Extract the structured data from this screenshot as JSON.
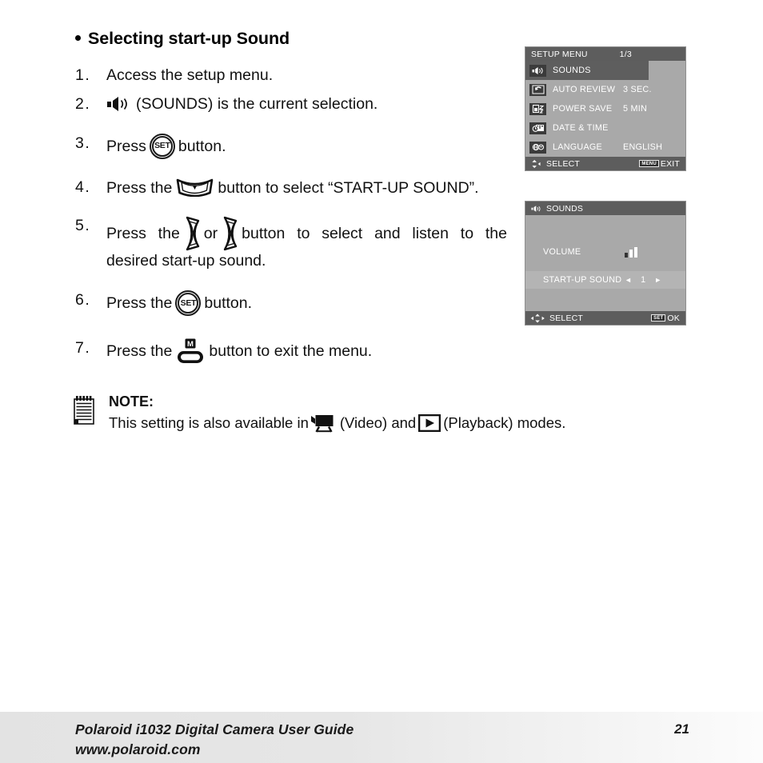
{
  "heading": "Selecting start-up Sound",
  "steps": [
    {
      "num": "1.",
      "text": "Access the setup menu."
    },
    {
      "num": "2.",
      "icon": "speaker-icon",
      "text": "(SOUNDS) is the current selection."
    },
    {
      "num": "3.",
      "pre": "Press",
      "icon": "set-button-icon",
      "post": "button."
    },
    {
      "num": "4.",
      "pre": "Press  the",
      "icon": "down-arrow-button-icon",
      "post": "button  to  select  “START-UP SOUND”."
    },
    {
      "num": "5.",
      "pre": "Press the",
      "icon": "macro-left-button-icon",
      "mid": "or",
      "icon2": "flash-right-button-icon",
      "post": "button to select and listen to the desired start-up sound."
    },
    {
      "num": "6.",
      "pre": "Press the",
      "icon": "set-button-icon",
      "post": "button."
    },
    {
      "num": "7.",
      "pre": "Press the",
      "icon": "menu-button-icon",
      "post": "button to exit the menu."
    }
  ],
  "note": {
    "icon": "notepad-icon",
    "title": "NOTE:",
    "text_before": "This setting is also available in",
    "video_icon": "video-camera-icon",
    "video_label": "(Video) and",
    "playback_icon": "play-button-icon",
    "playback_label": "(Playback) modes."
  },
  "lcd_setup": {
    "title": "SETUP MENU",
    "page": "1/3",
    "items": [
      {
        "icon": "speaker-icon",
        "label": "SOUNDS",
        "value": "",
        "selected": true
      },
      {
        "icon": "auto-review-icon",
        "label": "AUTO REVIEW",
        "value": "3 SEC.",
        "selected": false
      },
      {
        "icon": "power-save-icon",
        "label": "POWER SAVE",
        "value": "5 MIN",
        "selected": false
      },
      {
        "icon": "date-time-icon",
        "label": "DATE & TIME",
        "value": "",
        "selected": false
      },
      {
        "icon": "language-icon",
        "label": "LANGUAGE",
        "value": "ENGLISH",
        "selected": false
      }
    ],
    "footer_left": "SELECT",
    "footer_badge": "MENU",
    "footer_right": "EXIT"
  },
  "lcd_sounds": {
    "title": "SOUNDS",
    "title_icon": "speaker-icon",
    "volume_label": "VOLUME",
    "volume_bars": [
      0,
      1,
      1
    ],
    "startup_label": "START-UP SOUND",
    "startup_value": "1",
    "arrow_left": "◄",
    "arrow_right": "►",
    "footer_left": "SELECT",
    "footer_badge": "SET",
    "footer_right": "OK"
  },
  "page_footer": {
    "line1": "Polaroid i1032 Digital Camera User Guide",
    "line2": "www.polaroid.com",
    "page_number": "21"
  },
  "colors": {
    "lcd_body": "#a9a9a9",
    "lcd_bar": "#5d5d5d",
    "lcd_selected": "#5e5e5e",
    "lcd_text": "#ffffff",
    "ink": "#111111"
  }
}
